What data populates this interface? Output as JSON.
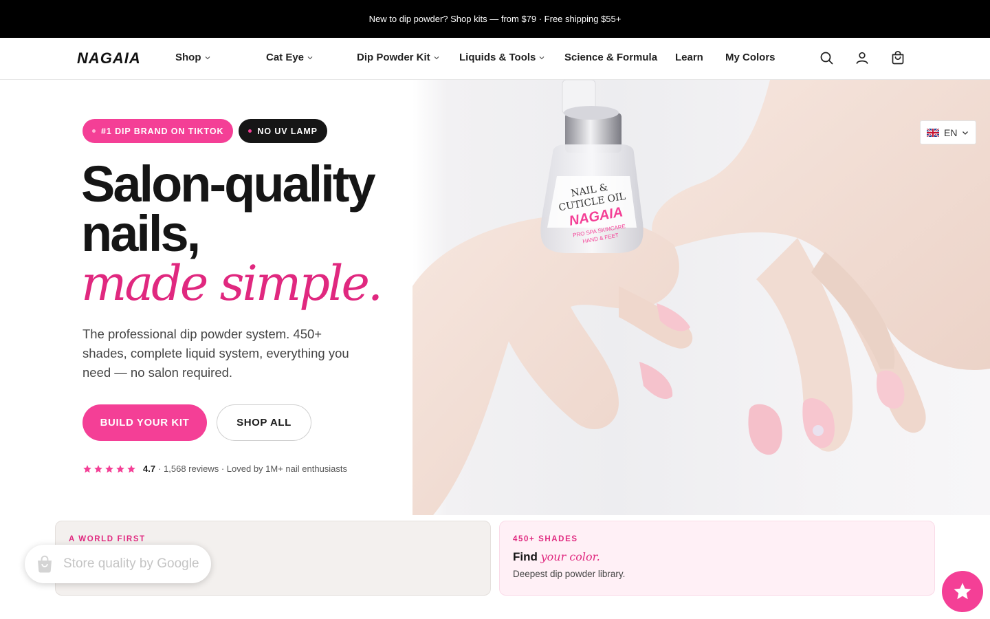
{
  "announcement": {
    "text": "New to dip powder? Shop kits — from $79 · Free shipping $55+"
  },
  "header": {
    "logo": "NAGAIA",
    "nav": [
      {
        "label": "Shop",
        "has_dropdown": true
      },
      {
        "label": "Cat Eye",
        "has_dropdown": true
      },
      {
        "label": "Dip Powder Kit",
        "has_dropdown": true
      },
      {
        "label": "Liquids & Tools",
        "has_dropdown": true
      },
      {
        "label": "Science & Formula",
        "has_dropdown": false
      },
      {
        "label": "Learn",
        "has_dropdown": false
      },
      {
        "label": "My Colors",
        "has_dropdown": false
      }
    ],
    "icons": [
      "search-icon",
      "account-icon",
      "cart-icon"
    ]
  },
  "hero": {
    "badges": [
      "#1 DIP BRAND ON TIKTOK",
      "NO UV LAMP"
    ],
    "headline_line1": "Salon-quality",
    "headline_line2": "nails,",
    "headline_italic": "made simple.",
    "subtext": "The professional dip powder system. 450+ shades, complete liquid system, everything you need — no salon required.",
    "cta_primary": "BUILD YOUR KIT",
    "cta_secondary": "SHOP ALL",
    "rating": {
      "stars": 5,
      "score": "4.7",
      "text": "· 1,568 reviews · Loved by 1M+ nail enthusiasts"
    },
    "image": {
      "bottle_text_line1": "NAIL &",
      "bottle_text_line2": "CUTICLE OIL",
      "bottle_brand": "NAGAIA",
      "bottle_sub_line1": "PRO SPA SKINCARE",
      "bottle_sub_line2": "HAND & FEET"
    }
  },
  "language": {
    "code": "EN",
    "flag": "uk-flag-icon"
  },
  "cards": [
    {
      "eyebrow": "A WORLD FIRST",
      "title": "",
      "title_italic": "",
      "desc": ""
    },
    {
      "eyebrow": "450+ SHADES",
      "title": "Find",
      "title_italic": "your color.",
      "desc": "Deepest dip powder library."
    }
  ],
  "google_badge": {
    "text": "Store quality by Google"
  },
  "colors": {
    "accent": "#f43f96",
    "accent_dark": "#e0287f",
    "announcement_bg": "#000000"
  }
}
